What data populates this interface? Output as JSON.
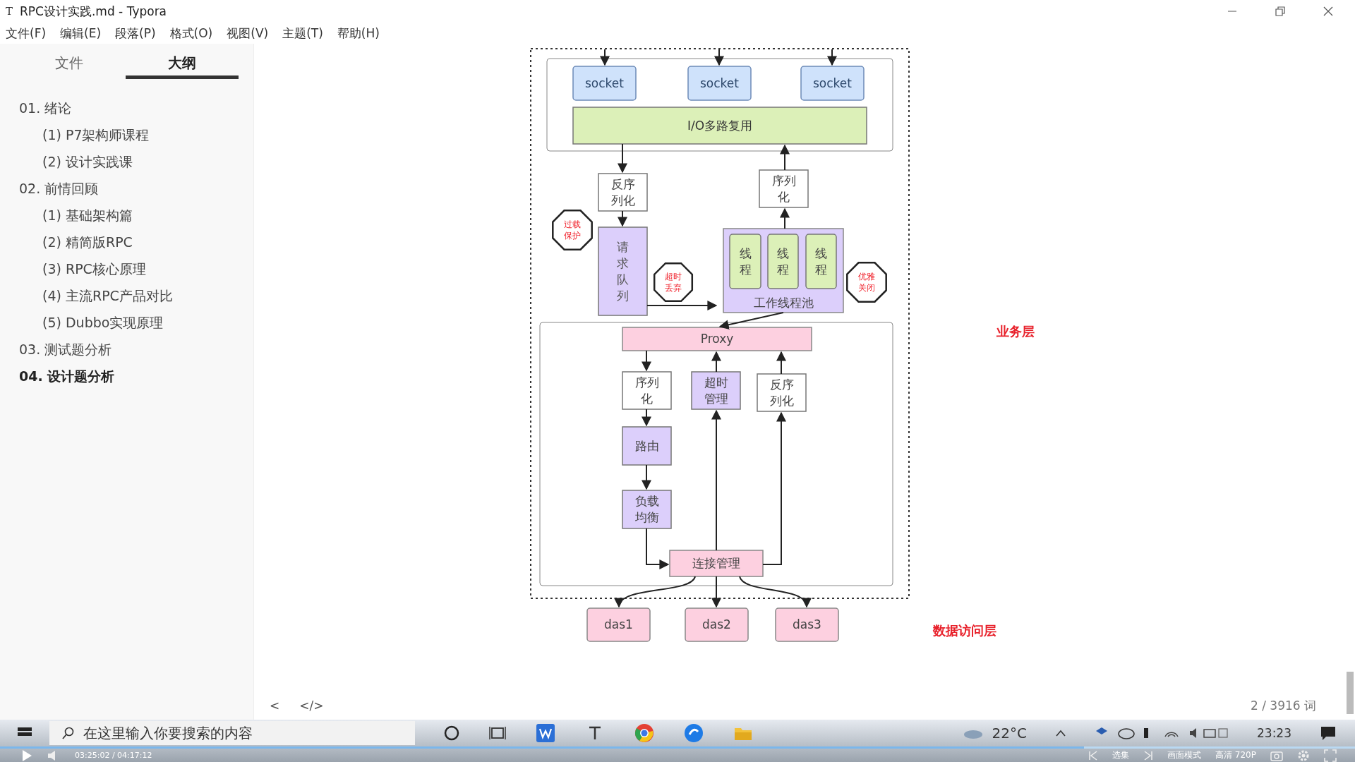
{
  "window": {
    "title": "RPC设计实践.md - Typora",
    "app_icon": "T"
  },
  "menu": [
    "文件(F)",
    "编辑(E)",
    "段落(P)",
    "格式(O)",
    "视图(V)",
    "主题(T)",
    "帮助(H)"
  ],
  "sidebar": {
    "tabs": [
      {
        "label": "文件",
        "selected": false
      },
      {
        "label": "大纲",
        "selected": true
      }
    ],
    "outline": [
      {
        "text": "01. 绪论",
        "selected": false,
        "children": [
          {
            "text": "(1) P7架构师课程",
            "selected": false
          },
          {
            "text": "(2) 设计实践课",
            "selected": false
          }
        ]
      },
      {
        "text": "02. 前情回顾",
        "selected": false,
        "children": [
          {
            "text": "(1) 基础架构篇",
            "selected": false
          },
          {
            "text": "(2) 精简版RPC",
            "selected": false
          },
          {
            "text": "(3) RPC核心原理",
            "selected": false
          },
          {
            "text": "(4) 主流RPC产品对比",
            "selected": false
          },
          {
            "text": "(5) Dubbo实现原理",
            "selected": false
          }
        ]
      },
      {
        "text": "03. 测试题分析",
        "selected": false
      },
      {
        "text": "04. 设计题分析",
        "selected": true
      }
    ]
  },
  "diagram": {
    "nodes": [
      {
        "text": "socket",
        "kind": "socket"
      },
      {
        "text": "socket",
        "kind": "socket"
      },
      {
        "text": "socket",
        "kind": "socket"
      },
      {
        "text": "I/O多路复用",
        "kind": "bar"
      },
      {
        "text": "反序列化",
        "kind": "box"
      },
      {
        "text": "序列化",
        "kind": "box"
      },
      {
        "text": "过载保护",
        "kind": "octagon"
      },
      {
        "text": "请求队列",
        "kind": "queue",
        "color": "#dccffb"
      },
      {
        "text": "超时丢弃",
        "kind": "octagon"
      },
      {
        "text": "工作线程池",
        "kind": "pool"
      },
      {
        "text": "线程",
        "kind": "thread"
      },
      {
        "text": "线程",
        "kind": "thread"
      },
      {
        "text": "线程",
        "kind": "thread"
      },
      {
        "text": "优雅关闭",
        "kind": "octagon"
      },
      {
        "text": "Proxy",
        "kind": "proxy"
      },
      {
        "text": "序列化",
        "kind": "box"
      },
      {
        "text": "超时管理",
        "kind": "box",
        "color": "#dccffb"
      },
      {
        "text": "反序列化",
        "kind": "box"
      },
      {
        "text": "路由",
        "kind": "box",
        "color": "#dccffb"
      },
      {
        "text": "负载均衡",
        "kind": "box",
        "color": "#dccffb"
      },
      {
        "text": "连接管理",
        "kind": "proxy"
      },
      {
        "text": "das1",
        "kind": "db"
      },
      {
        "text": "das2",
        "kind": "db"
      },
      {
        "text": "das3",
        "kind": "db"
      }
    ],
    "layers": [
      "业务层",
      "数据访问层"
    ]
  },
  "footer": {
    "word_count": "2 / 3916 词",
    "back": "<",
    "source": "</>"
  },
  "taskbar": {
    "search": {
      "placeholder": "在这里输入你要搜索的内容"
    },
    "temperature": "22°C",
    "time": "23:23"
  },
  "player": {
    "time": "03:25:02 / 04:17:12",
    "level": 0.8,
    "buttons": [
      "选集",
      "画面模式",
      "高清 720P"
    ]
  }
}
